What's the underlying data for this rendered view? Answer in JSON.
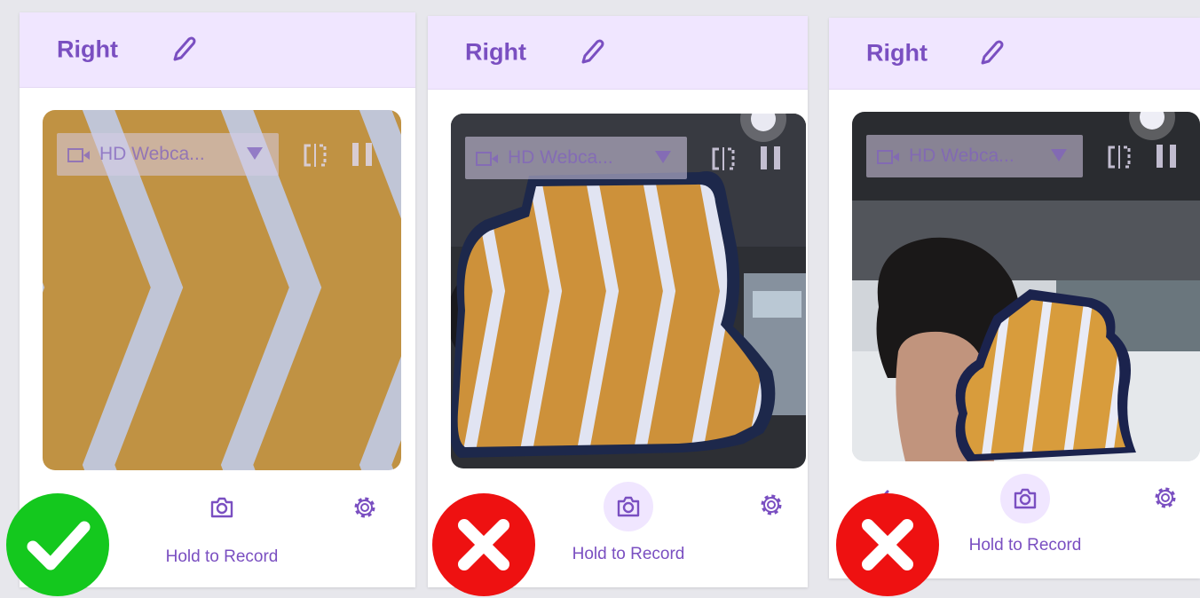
{
  "panels": [
    {
      "title": "Right",
      "camera_device": "HD Webca...",
      "record_label": "Hold to Record",
      "result": "correct"
    },
    {
      "title": "Right",
      "camera_device": "HD Webca...",
      "record_label": "Hold to Record",
      "result": "incorrect"
    },
    {
      "title": "Right",
      "camera_device": "HD Webca...",
      "record_label": "Hold to Record",
      "result": "incorrect"
    }
  ],
  "colors": {
    "accent": "#7a4fc1",
    "header_bg": "#f0e6ff",
    "correct": "#14c81e",
    "incorrect": "#ee1111",
    "stripe_orange": "#c9973f",
    "stripe_white": "#c8d0e0"
  },
  "icons": [
    "edit-pencil-icon",
    "video-camera-icon",
    "dropdown-caret-icon",
    "flip-camera-icon",
    "pause-icon",
    "camera-icon",
    "gear-icon",
    "checkmark-icon",
    "x-mark-icon"
  ]
}
